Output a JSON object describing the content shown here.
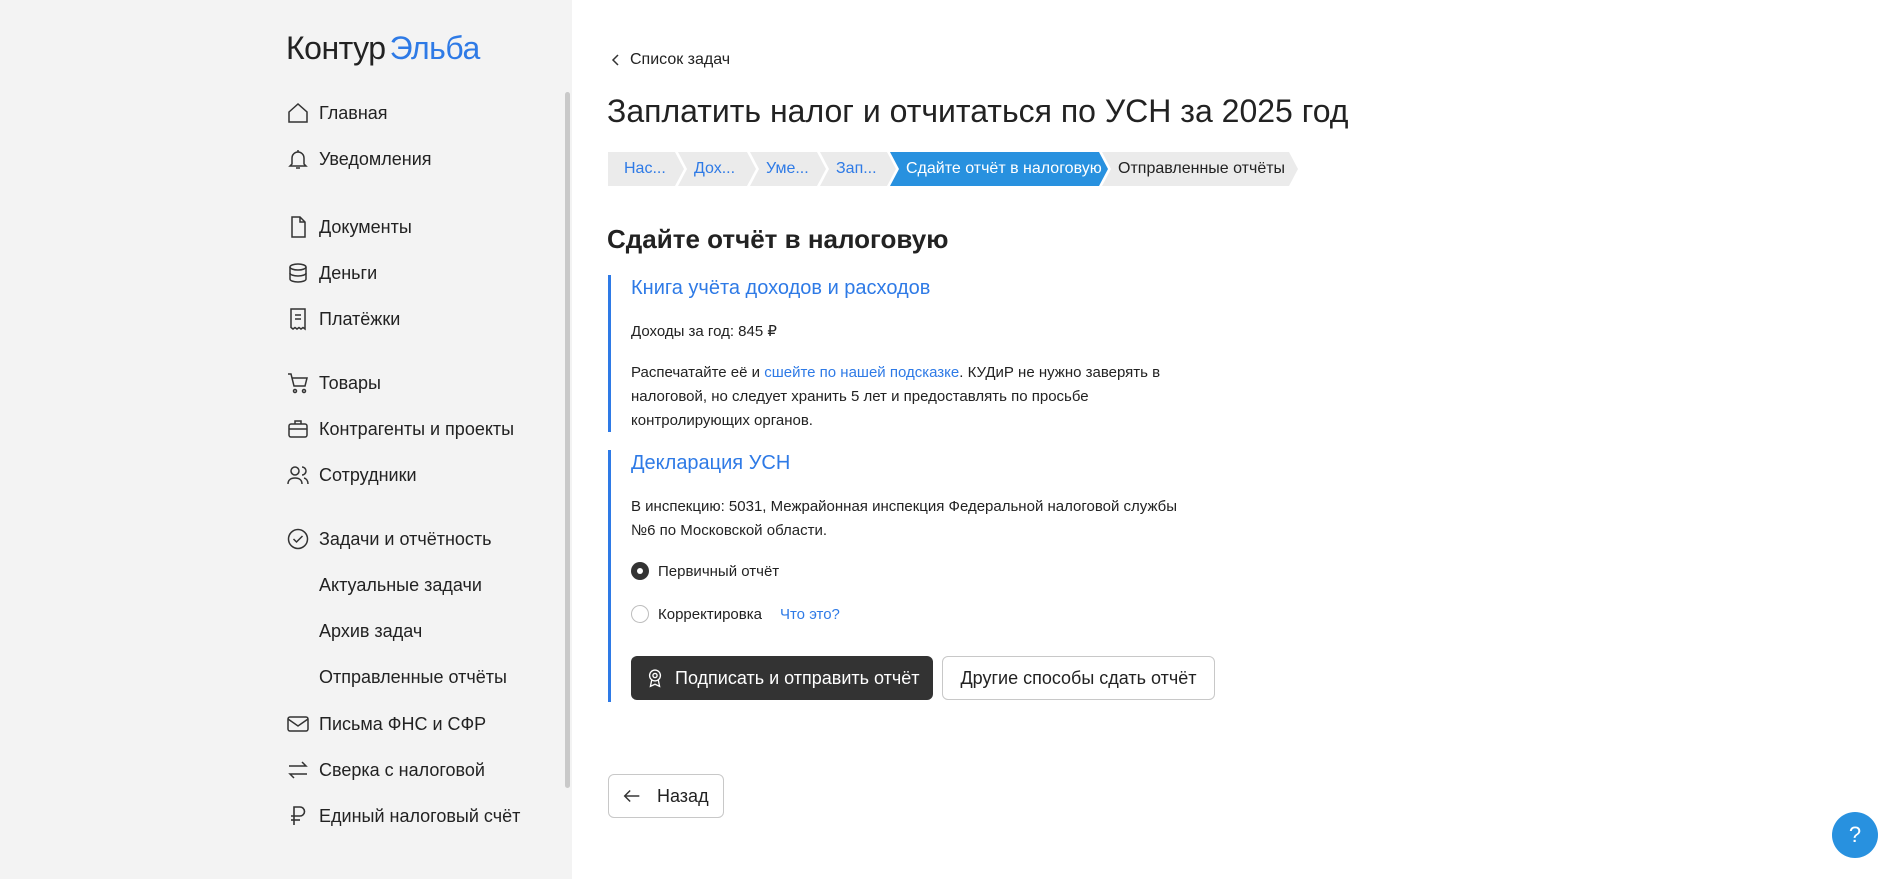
{
  "logo": {
    "kontur": "Контур",
    "elba": "Эльба"
  },
  "sidebar": {
    "items": [
      {
        "label": "Главная",
        "icon": "home-icon"
      },
      {
        "label": "Уведомления",
        "icon": "bell-icon"
      },
      {
        "label": "Документы",
        "icon": "document-icon"
      },
      {
        "label": "Деньги",
        "icon": "coins-icon"
      },
      {
        "label": "Платёжки",
        "icon": "receipt-icon"
      },
      {
        "label": "Товары",
        "icon": "cart-icon"
      },
      {
        "label": "Контрагенты и проекты",
        "icon": "briefcase-icon"
      },
      {
        "label": "Сотрудники",
        "icon": "people-icon"
      },
      {
        "label": "Задачи и отчётность",
        "icon": "check-circle-icon"
      },
      {
        "label": "Письма ФНС и СФР",
        "icon": "mail-icon"
      },
      {
        "label": "Сверка с налоговой",
        "icon": "swap-arrows-icon"
      },
      {
        "label": "Единый налоговый счёт",
        "icon": "ruble-icon"
      }
    ],
    "subitems": [
      {
        "label": "Актуальные задачи"
      },
      {
        "label": "Архив задач"
      },
      {
        "label": "Отправленные отчёты"
      }
    ]
  },
  "main": {
    "back_link": "Список задач",
    "title": "Заплатить налог и отчитаться по УСН за 2025 год",
    "steps": [
      {
        "label": "Нас..."
      },
      {
        "label": "Дох..."
      },
      {
        "label": "Уме..."
      },
      {
        "label": "Зап..."
      },
      {
        "label": "Сдайте отчёт в налоговую"
      },
      {
        "label": "Отправленные отчёты"
      }
    ],
    "section_title": "Сдайте отчёт в налоговую",
    "book": {
      "title": "Книга учёта доходов и расходов",
      "income": "Доходы за год: 845 ₽",
      "text_before_link": "Распечатайте её и ",
      "link": "сшейте по нашей подсказке",
      "text_after_link": ". КУДиР не нужно заверять в налоговой, но следует хранить 5 лет и предоставлять по просьбе контролирующих органов."
    },
    "declaration": {
      "title": "Декларация УСН",
      "inspection": "В инспекцию: 5031, Межрайонная инспекция Федеральной налоговой службы №6 по Московской области.",
      "options": [
        {
          "label": "Первичный отчёт",
          "checked": true
        },
        {
          "label": "Корректировка",
          "checked": false
        }
      ],
      "help_link": "Что это?",
      "primary_button": "Подписать и отправить отчёт",
      "secondary_button": "Другие способы сдать отчёт"
    },
    "back_button": "Назад"
  },
  "help_button": "?",
  "colors": {
    "accent": "#2e7ae6",
    "active_step": "#2891df",
    "dark_button": "#333333",
    "sidebar_bg": "#f3f3f3"
  }
}
